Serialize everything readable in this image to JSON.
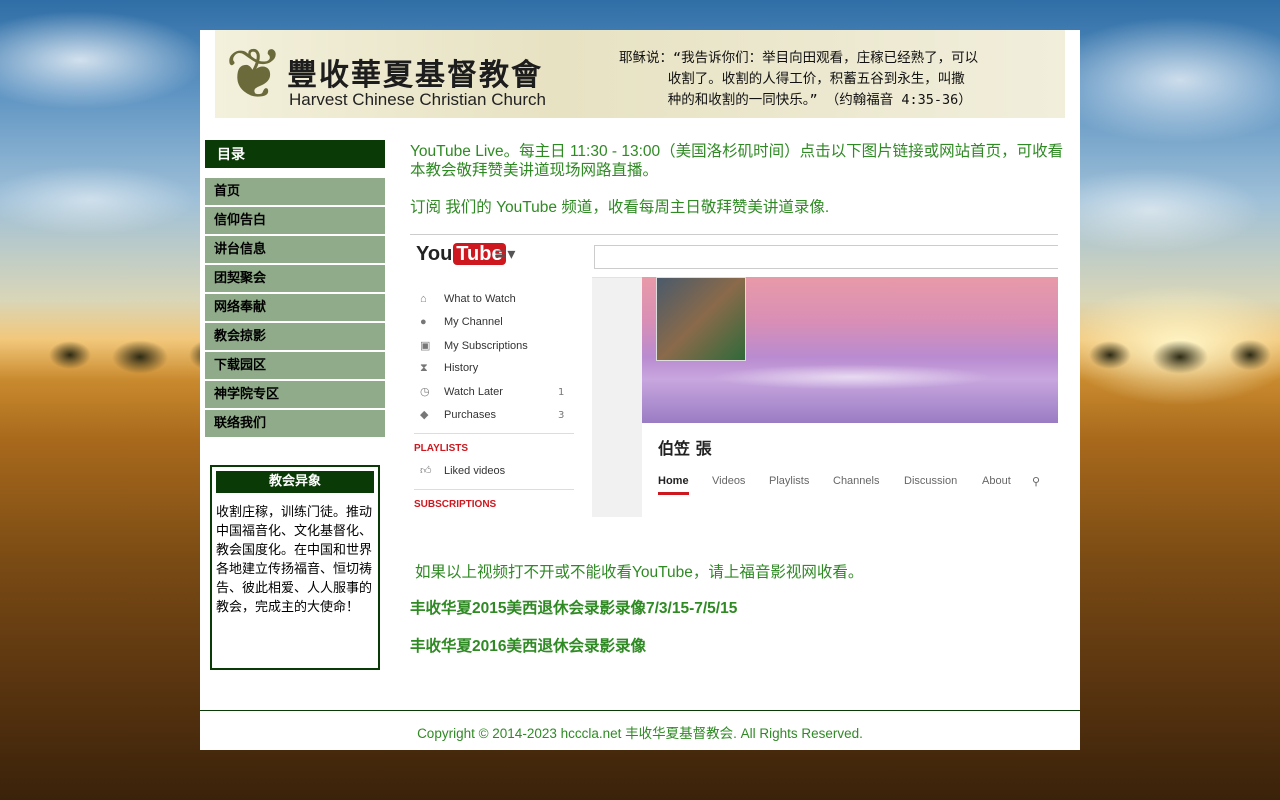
{
  "header": {
    "title_cn": "豐收華夏基督教會",
    "title_en": "Harvest Chinese Christian Church",
    "quote": "耶稣说：“我告诉你们：举目向田观看，庄稼已经熟了，可以\n      收割了。收割的人得工价，积蓄五谷到永生，叫撒\n      种的和收割的一同快乐。” （约翰福音 4:35-36）"
  },
  "sidebar": {
    "heading": "目录",
    "items": [
      {
        "label": "首页"
      },
      {
        "label": "信仰告白"
      },
      {
        "label": "讲台信息"
      },
      {
        "label": "团契聚会"
      },
      {
        "label": "网络奉献"
      },
      {
        "label": "教会掠影"
      },
      {
        "label": "下载园区"
      },
      {
        "label": "神学院专区"
      },
      {
        "label": "联络我们"
      }
    ],
    "vision": {
      "heading": "教会异象",
      "text": "收割庄稼，训练门徒。推动中国福音化、文化基督化、教会国度化。在中国和世界各地建立传扬福音、恒切祷告、彼此相爱、人人服事的教会，完成主的大使命！"
    }
  },
  "main": {
    "p1": "YouTube Live。每主日 11:30 - 13:00（美国洛杉矶时间）点击以下图片链接或网站首页，可收看本教会敬拜赞美讲道现场网路直播。",
    "p2": "订阅 我们的 YouTube 频道，收看每周主日敬拜赞美讲道录像.",
    "youtube": {
      "logo_you": "You",
      "logo_tube": "Tube",
      "nav": [
        {
          "label": "What to Watch",
          "count": ""
        },
        {
          "label": "My Channel",
          "count": ""
        },
        {
          "label": "My Subscriptions",
          "count": ""
        },
        {
          "label": "History",
          "count": ""
        },
        {
          "label": "Watch Later",
          "count": "1"
        },
        {
          "label": "Purchases",
          "count": "3"
        }
      ],
      "playlists_heading": "PLAYLISTS",
      "liked": "Liked videos",
      "subscriptions_heading": "SUBSCRIPTIONS",
      "channel_name": "伯笠 張",
      "tabs": [
        "Home",
        "Videos",
        "Playlists",
        "Channels",
        "Discussion",
        "About"
      ]
    },
    "p3": "如果以上视频打不开或不能收看YouTube，请上福音影视网收看。",
    "link1": "丰收华夏2015美西退休会录影录像7/3/15-7/5/15",
    "link2": "丰收华夏2016美西退休会录影录像"
  },
  "footer": {
    "text": "Copyright © 2014-2023  hcccla.net 丰收华夏基督教会. All Rights Reserved."
  },
  "colors": {
    "accent_green": "#2f8a24",
    "dark_green": "#0a3a06",
    "menu_green": "#8fab89",
    "youtube_red": "#cc181e"
  }
}
